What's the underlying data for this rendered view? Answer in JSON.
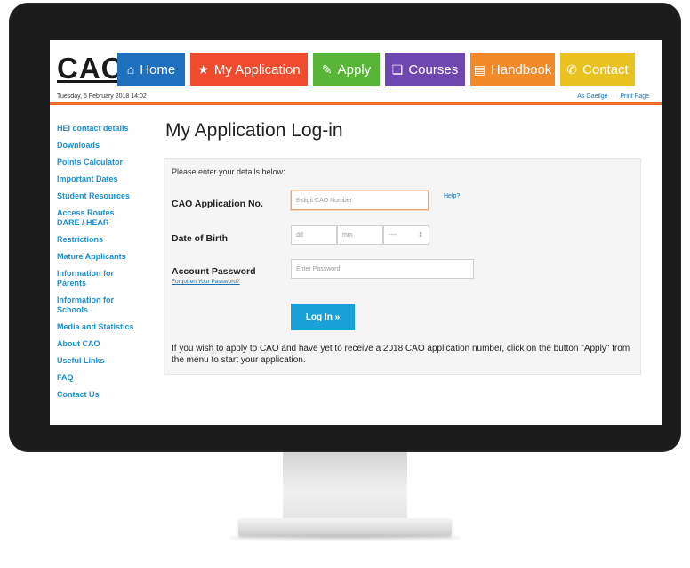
{
  "header": {
    "logo": "CAO",
    "nav": [
      {
        "label": "Home",
        "icon": "home-icon",
        "glyph": "⌂",
        "color": "#1f6fbf"
      },
      {
        "label": "My Application",
        "icon": "star-icon",
        "glyph": "★",
        "color": "#ee4b2f"
      },
      {
        "label": "Apply",
        "icon": "edit-icon",
        "glyph": "✎",
        "color": "#59b538"
      },
      {
        "label": "Courses",
        "icon": "book-icon",
        "glyph": "❏",
        "color": "#6e47b0"
      },
      {
        "label": "Handbook",
        "icon": "handbook-icon",
        "glyph": "▤",
        "color": "#f28a2a"
      },
      {
        "label": "Contact",
        "icon": "phone-icon",
        "glyph": "✆",
        "color": "#e9c21f"
      }
    ],
    "date": "Tuesday, 6 February 2018 14:02",
    "links": {
      "gaeilge": "As Gaeilge",
      "print": "Print Page",
      "separator": "|"
    }
  },
  "sidebar": {
    "items": [
      "HEI contact details",
      "Downloads",
      "Points Calculator",
      "Important Dates",
      "Student Resources",
      "Access Routes",
      "DARE / HEAR",
      "Restrictions",
      "Mature Applicants",
      "Information for Parents",
      "Information for Schools",
      "Media and Statistics",
      "About CAO",
      "Useful Links",
      "FAQ",
      "Contact Us"
    ]
  },
  "main": {
    "title": "My Application Log-in",
    "intro": "Please enter your details below:",
    "app_no_label": "CAO Application No.",
    "app_no_placeholder": "8-digit CAO Number",
    "help": "Help?",
    "dob_label": "Date of Birth",
    "dob_dd": "dd",
    "dob_mm": "mm",
    "dob_yyyy": "----",
    "password_label": "Account Password",
    "password_placeholder": "Enter Password",
    "forgot": "Forgotten Your Password?",
    "login_button": "Log In »",
    "note": "If you wish to apply to CAO and have yet to receive a 2018 CAO application number, click on the button \"Apply\" from the menu to start your application."
  }
}
